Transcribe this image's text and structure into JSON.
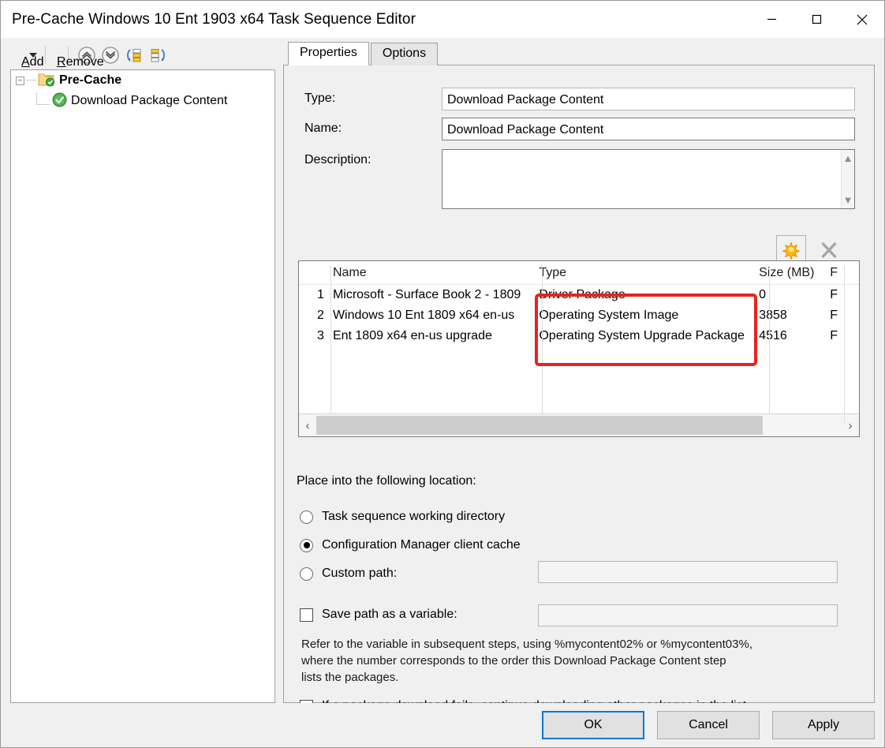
{
  "window": {
    "title": "Pre-Cache Windows 10 Ent 1903 x64 Task Sequence Editor",
    "minimize_label": "Minimize",
    "maximize_label": "Maximize",
    "close_label": "Close"
  },
  "toolbar": {
    "add_label": "Add",
    "add_accel": "A",
    "add_rest": "dd",
    "remove_label": "Remove",
    "remove_accel": "R",
    "remove_rest": "emove",
    "move_up_label": "Move Up",
    "move_down_label": "Move Down",
    "add_group_label": "Add Group",
    "copy_label": "Copy"
  },
  "tree": {
    "root": {
      "label": "Pre-Cache",
      "expander": "−"
    },
    "child": {
      "label": "Download Package Content"
    }
  },
  "tabs": [
    {
      "label": "Properties",
      "active": true
    },
    {
      "label": "Options",
      "active": false
    }
  ],
  "fields": {
    "type_label": "Type:",
    "type_value": "Download Package Content",
    "name_label": "Name:",
    "name_value": "Download Package Content",
    "description_label": "Description:",
    "description_value": ""
  },
  "content_buttons": {
    "add_package_label": "Add Package",
    "remove_package_label": "Remove Package"
  },
  "packages_table": {
    "columns": [
      "",
      "Name",
      "Type",
      "Size (MB)",
      "F"
    ],
    "rows": [
      {
        "idx": "1",
        "name": "Microsoft - Surface Book 2 - 1809",
        "type": "Driver Package",
        "size": "0",
        "more": "F"
      },
      {
        "idx": "2",
        "name": "Windows 10 Ent 1809 x64 en-us",
        "type": "Operating System Image",
        "size": "3858",
        "more": "F"
      },
      {
        "idx": "3",
        "name": "Ent 1809 x64 en-us upgrade",
        "type": "Operating System Upgrade Package",
        "size": "4516",
        "more": "F"
      }
    ],
    "scroll_left_glyph": "‹",
    "scroll_right_glyph": "›"
  },
  "annotation": {
    "color": "#e8231f",
    "target": "type-column-highlight"
  },
  "location": {
    "group_label": "Place into the following location:",
    "options": [
      {
        "label": "Task sequence working directory",
        "selected": false
      },
      {
        "label": "Configuration Manager client cache",
        "selected": true
      },
      {
        "label": "Custom path:",
        "selected": false
      }
    ],
    "custom_path_value": ""
  },
  "variable": {
    "save_path_label": "Save path as a variable:",
    "save_path_checked": false,
    "save_path_value": "",
    "help_line1": "Refer to the variable in subsequent steps, using %mycontent02% or %mycontent03%,",
    "help_line2": "where the number corresponds to the order this Download Package Content step",
    "help_line3": "lists the packages."
  },
  "continue_option": {
    "label": "If a package download fails, continue downloading other packages in the list",
    "checked": true
  },
  "footer": {
    "ok_label": "OK",
    "cancel_label": "Cancel",
    "apply_label": "Apply"
  },
  "colors": {
    "accent": "#0078d7",
    "link": "#8b2e6b",
    "annotation": "#e8231f"
  }
}
